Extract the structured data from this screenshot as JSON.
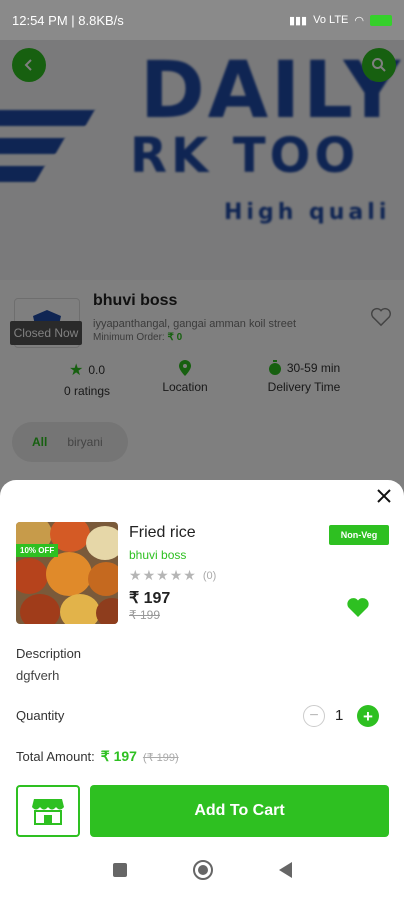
{
  "status_bar": {
    "time_speed": "12:54 PM | 8.8KB/s",
    "signal_text": "Vo LTE"
  },
  "banner": {
    "line1": "DAILY",
    "line2": "RK TOO",
    "line3": "High quali"
  },
  "store": {
    "closed_label": "Closed Now",
    "name": "bhuvi boss",
    "address": "iyyapanthangal, gangai amman koil street",
    "min_order_label": "Minimum Order:",
    "min_order_value": "₹ 0",
    "rating_value": "0.0",
    "rating_label": "0 ratings",
    "location_label": "Location",
    "delivery_value": "30-59 min",
    "delivery_label": "Delivery Time"
  },
  "category_tabs": [
    {
      "label": "All"
    },
    {
      "label": "biryani"
    }
  ],
  "product": {
    "discount": "10% OFF",
    "name": "Fried rice",
    "store": "bhuvi boss",
    "rating_count": "(0)",
    "price": "₹ 197",
    "old_price": "₹ 199",
    "tag": "Non-Veg",
    "description_label": "Description",
    "description": "dgfverh",
    "quantity_label": "Quantity",
    "quantity": "1",
    "total_label": "Total Amount:",
    "total_price": "₹ 197",
    "total_old": "(₹ 199)",
    "add_to_cart": "Add To Cart"
  },
  "colors": {
    "accent": "#2ec021",
    "brand_blue": "#1f4aa6"
  },
  "icons": {
    "back": "back-arrow-icon",
    "search": "search-icon",
    "favorite_outline": "heart-outline-icon",
    "star": "star-icon",
    "location": "location-pin-icon",
    "timer": "timer-icon",
    "close": "close-icon",
    "favorite_filled": "heart-filled-icon",
    "store": "store-icon"
  }
}
